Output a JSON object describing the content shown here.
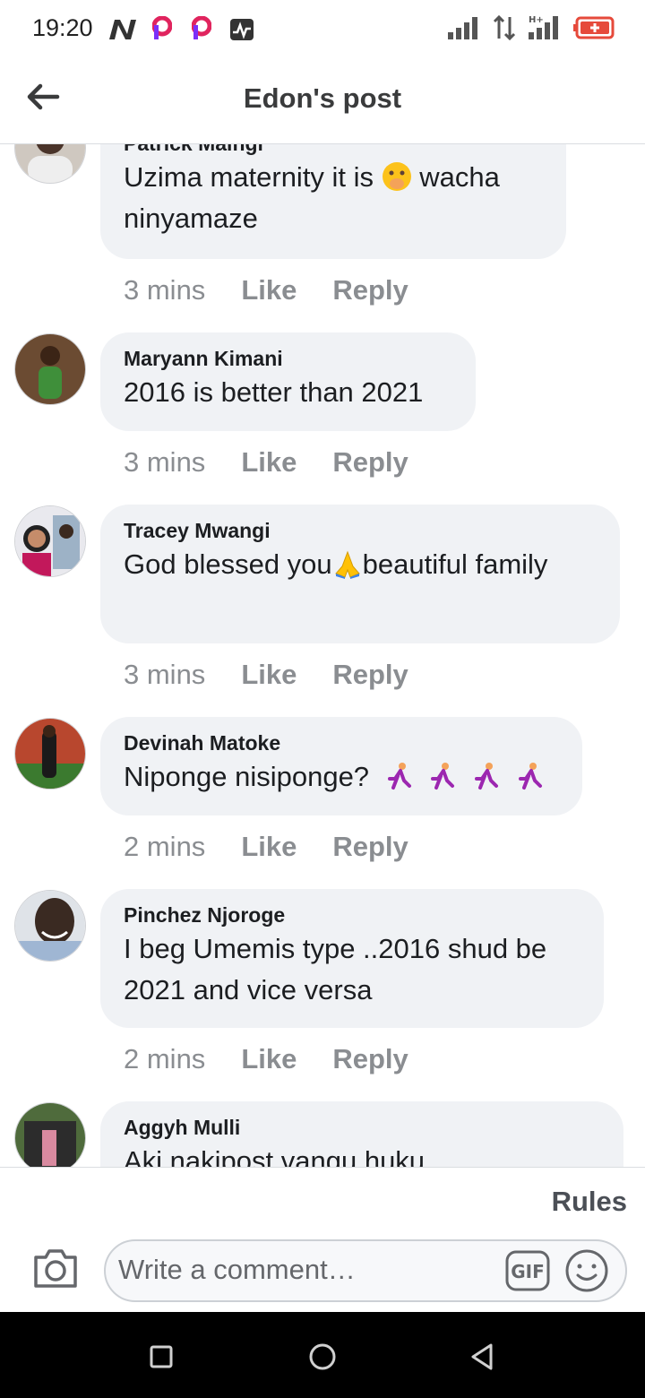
{
  "status_bar": {
    "time": "19:20"
  },
  "header": {
    "title": "Edon's post"
  },
  "comments": [
    {
      "author": "Patrick Maingi",
      "text_parts": [
        "Uzima maternity it is ",
        " wacha ninyamaze"
      ],
      "emoji": "shushing-face-emoji",
      "time": "3 mins",
      "like": "Like",
      "reply": "Reply"
    },
    {
      "author": "Maryann Kimani",
      "text": "2016 is better than 2021",
      "time": "3 mins",
      "like": "Like",
      "reply": "Reply"
    },
    {
      "author": "Tracey Mwangi",
      "text_parts": [
        "God blessed you",
        "beautiful family"
      ],
      "emoji": "folded-hands-emoji",
      "time": "3 mins",
      "like": "Like",
      "reply": "Reply"
    },
    {
      "author": "Devinah Matoke",
      "text": "Niponge nisiponge?",
      "emoji": "running-woman-emoji",
      "emoji_count": 4,
      "time": "2 mins",
      "like": "Like",
      "reply": "Reply"
    },
    {
      "author": "Pinchez Njoroge",
      "text_parts": [
        "I beg Umemis type ..2016 shud be",
        "2021 and vice versa"
      ],
      "time": "2 mins",
      "like": "Like",
      "reply": "Reply"
    },
    {
      "author": "Aggyh Mulli",
      "text": "Aki nakipost vangu huku"
    }
  ],
  "compose": {
    "rules": "Rules",
    "placeholder": "Write a comment…",
    "gif": "GIF"
  },
  "colors": {
    "bubble": "#f0f2f5",
    "meta_text": "#8a8d91",
    "battery": "#e64a3b"
  },
  "icons": [
    "network-n-icon",
    "p-app-icon",
    "activity-icon",
    "signal-icon",
    "data-arrows-icon",
    "battery-icon",
    "back-arrow-icon",
    "camera-icon",
    "gif-icon",
    "emoji-icon",
    "nav-square-icon",
    "nav-circle-icon",
    "nav-back-triangle-icon"
  ]
}
